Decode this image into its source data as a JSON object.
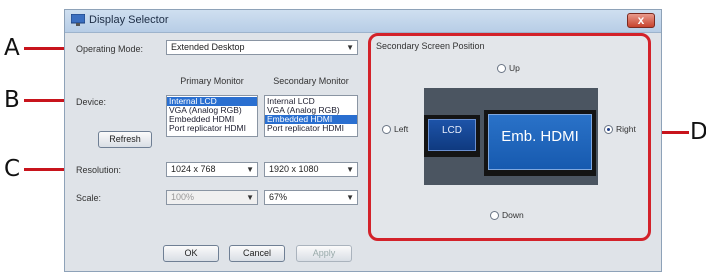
{
  "window": {
    "title": "Display Selector",
    "close_label": "x"
  },
  "callouts": [
    "A",
    "B",
    "C",
    "D"
  ],
  "operating_mode": {
    "label": "Operating Mode:",
    "value": "Extended Desktop"
  },
  "columns": {
    "primary": "Primary Monitor",
    "secondary": "Secondary Monitor"
  },
  "device": {
    "label": "Device:",
    "primary_items": [
      "Internal LCD",
      "VGA (Analog RGB)",
      "Embedded HDMI",
      "Port replicator HDMI"
    ],
    "primary_selected": "Internal LCD",
    "secondary_items": [
      "Internal LCD",
      "VGA (Analog RGB)",
      "Embedded HDMI",
      "Port replicator HDMI"
    ],
    "secondary_selected": "Embedded HDMI",
    "refresh_label": "Refresh"
  },
  "resolution": {
    "label": "Resolution:",
    "primary": "1024 x 768",
    "secondary": "1920 x 1080"
  },
  "scale": {
    "label": "Scale:",
    "primary": "100%",
    "secondary": "67%"
  },
  "buttons": {
    "ok": "OK",
    "cancel": "Cancel",
    "apply": "Apply"
  },
  "position_panel": {
    "title": "Secondary Screen Position",
    "up": "Up",
    "down": "Down",
    "left": "Left",
    "right": "Right",
    "selected": "Right",
    "lcd_label": "LCD",
    "hdmi_label": "Emb. HDMI"
  },
  "colors": {
    "callout_red": "#c8141c",
    "selection_blue": "#2a6fd0"
  }
}
